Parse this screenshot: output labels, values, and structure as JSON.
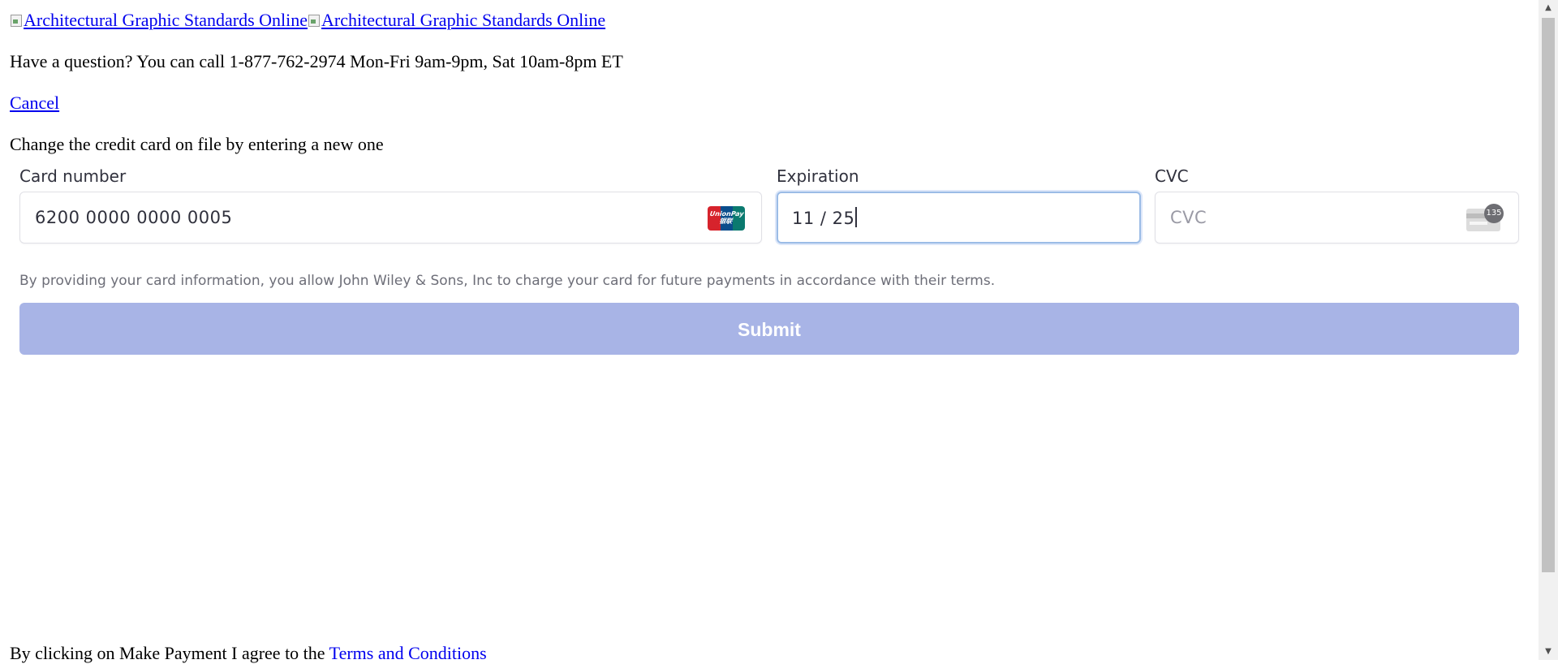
{
  "header": {
    "logo_alt_1": "Architectural Graphic Standards Online",
    "logo_alt_2": "Architectural Graphic Standards Online"
  },
  "question": "Have a question? You can call 1-877-762-2974 Mon-Fri 9am-9pm, Sat 10am-8pm ET",
  "cancel_label": "Cancel",
  "intro": "Change the credit card on file by entering a new one",
  "form": {
    "card_number": {
      "label": "Card number",
      "value": "6200 0000 0000 0005",
      "brand_icon": "unionpay-icon",
      "brand_text": "UnionPay 银联"
    },
    "expiration": {
      "label": "Expiration",
      "value": "11 / 25"
    },
    "cvc": {
      "label": "CVC",
      "placeholder": "CVC",
      "icon_badge": "135"
    },
    "authorization_note": "By providing your card information, you allow John Wiley & Sons, Inc to charge your card for future payments in accordance with their terms.",
    "submit_label": "Submit"
  },
  "footer": {
    "prefix": "By clicking on Make Payment I agree to the",
    "link": "Terms and Conditions"
  },
  "colors": {
    "link": "#0000ee",
    "submit_bg": "#a8b4e6",
    "focus_border": "#9bbce6",
    "note_text": "#6d6e78"
  },
  "scrollbar": {
    "up_arrow": "▲",
    "down_arrow": "▼"
  }
}
